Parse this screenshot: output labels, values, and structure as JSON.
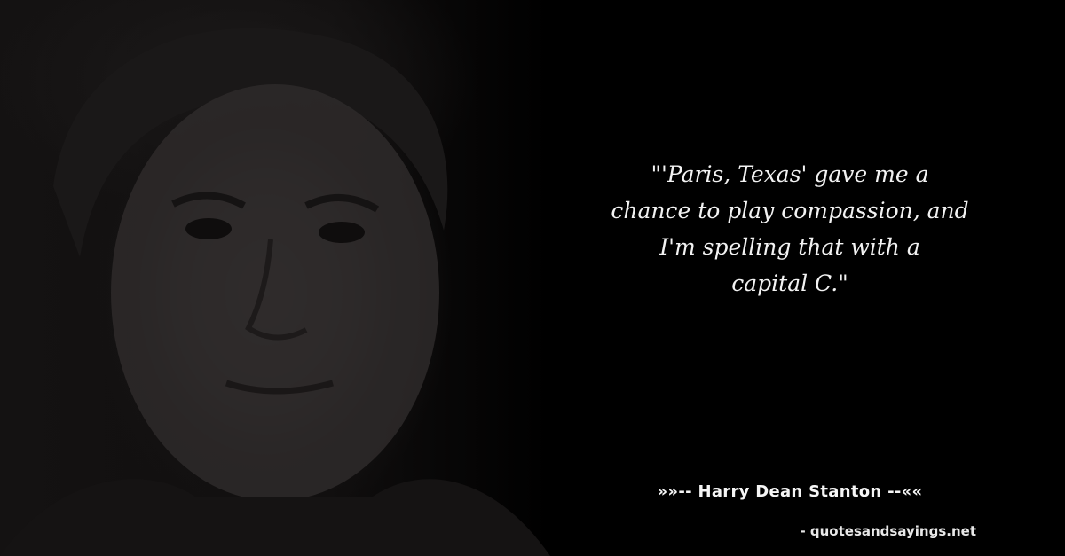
{
  "background_color": "#000000",
  "portrait": {
    "subject": "elderly man portrait, darkened"
  },
  "quote": {
    "lines": [
      "\"'Paris, Texas' gave me a",
      "chance to play compassion, and",
      "I'm spelling that with a",
      "capital C.\""
    ]
  },
  "author": {
    "text": "»»-- Harry Dean Stanton --««"
  },
  "source": {
    "text": "- quotesandsayings.net"
  },
  "text_color": "#f2f2f2"
}
